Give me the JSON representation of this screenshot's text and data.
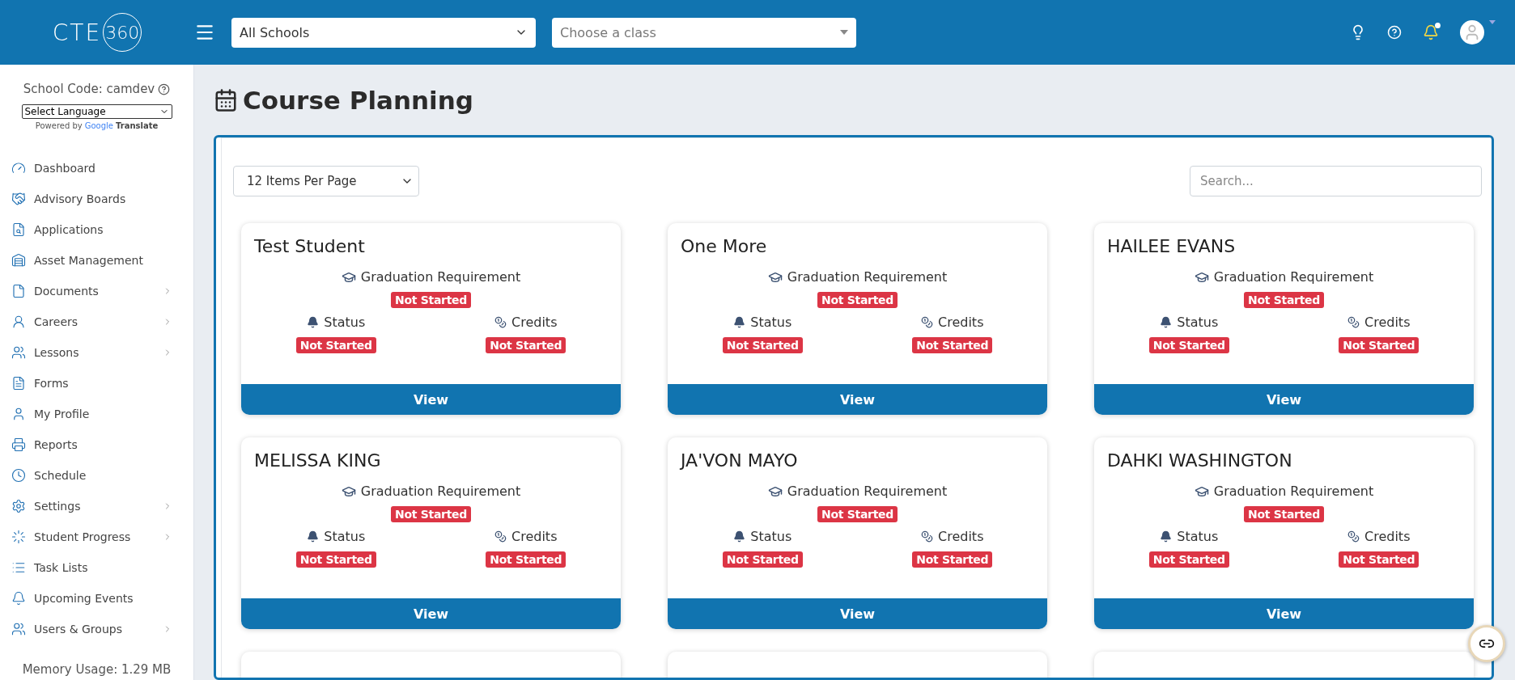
{
  "header": {
    "logo_text": "CTE",
    "logo_badge": "360",
    "school_select": "All Schools",
    "class_select": {
      "placeholder": "Choose a class"
    },
    "notifications_unread": true
  },
  "sidebar": {
    "school_code": "School Code: camdev",
    "language_select": "Select Language",
    "powered_by": "Powered by",
    "google": "Google",
    "translate": "Translate",
    "items": [
      {
        "label": "Dashboard",
        "has_submenu": false
      },
      {
        "label": "Advisory Boards",
        "has_submenu": false
      },
      {
        "label": "Applications",
        "has_submenu": false
      },
      {
        "label": "Asset Management",
        "has_submenu": false
      },
      {
        "label": "Documents",
        "has_submenu": true
      },
      {
        "label": "Careers",
        "has_submenu": true
      },
      {
        "label": "Lessons",
        "has_submenu": true
      },
      {
        "label": "Forms",
        "has_submenu": false
      },
      {
        "label": "My Profile",
        "has_submenu": false
      },
      {
        "label": "Reports",
        "has_submenu": false
      },
      {
        "label": "Schedule",
        "has_submenu": false
      },
      {
        "label": "Settings",
        "has_submenu": true
      },
      {
        "label": "Student Progress",
        "has_submenu": true
      },
      {
        "label": "Task Lists",
        "has_submenu": false
      },
      {
        "label": "Upcoming Events",
        "has_submenu": false
      },
      {
        "label": "Users & Groups",
        "has_submenu": true
      }
    ],
    "memory": "Memory Usage: 1.29 MB"
  },
  "page": {
    "title": "Course Planning",
    "per_page": "12 Items Per Page",
    "search": {
      "placeholder": "Search..."
    },
    "cards": [
      {
        "name": "Test Student",
        "graduation_label": "Graduation Requirement",
        "graduation_status": "Not Started",
        "status_label": "Status",
        "status_value": "Not Started",
        "credits_label": "Credits",
        "credits_value": "Not Started",
        "button": "View"
      },
      {
        "name": "One More",
        "graduation_label": "Graduation Requirement",
        "graduation_status": "Not Started",
        "status_label": "Status",
        "status_value": "Not Started",
        "credits_label": "Credits",
        "credits_value": "Not Started",
        "button": "View"
      },
      {
        "name": "HAILEE EVANS",
        "graduation_label": "Graduation Requirement",
        "graduation_status": "Not Started",
        "status_label": "Status",
        "status_value": "Not Started",
        "credits_label": "Credits",
        "credits_value": "Not Started",
        "button": "View"
      },
      {
        "name": "MELISSA KING",
        "graduation_label": "Graduation Requirement",
        "graduation_status": "Not Started",
        "status_label": "Status",
        "status_value": "Not Started",
        "credits_label": "Credits",
        "credits_value": "Not Started",
        "button": "View"
      },
      {
        "name": "JA'VON MAYO",
        "graduation_label": "Graduation Requirement",
        "graduation_status": "Not Started",
        "status_label": "Status",
        "status_value": "Not Started",
        "credits_label": "Credits",
        "credits_value": "Not Started",
        "button": "View"
      },
      {
        "name": "DAHKI WASHINGTON",
        "graduation_label": "Graduation Requirement",
        "graduation_status": "Not Started",
        "status_label": "Status",
        "status_value": "Not Started",
        "credits_label": "Credits",
        "credits_value": "Not Started",
        "button": "View"
      }
    ]
  }
}
